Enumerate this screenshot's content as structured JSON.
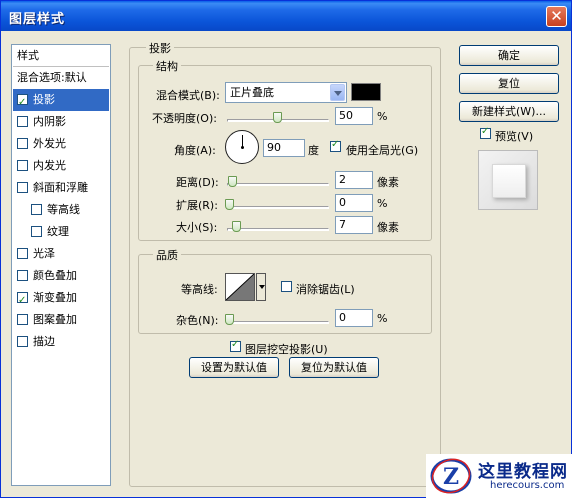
{
  "window": {
    "title": "图层样式",
    "close_glyph": "✕"
  },
  "style_list": {
    "header": "样式",
    "items": [
      {
        "label": "混合选项:默认",
        "checkbox": false,
        "checked": false,
        "selected": false
      },
      {
        "label": "投影",
        "checkbox": true,
        "checked": true,
        "selected": true
      },
      {
        "label": "内阴影",
        "checkbox": true,
        "checked": false,
        "selected": false
      },
      {
        "label": "外发光",
        "checkbox": true,
        "checked": false,
        "selected": false
      },
      {
        "label": "内发光",
        "checkbox": true,
        "checked": false,
        "selected": false
      },
      {
        "label": "斜面和浮雕",
        "checkbox": true,
        "checked": false,
        "selected": false
      },
      {
        "label": "等高线",
        "checkbox": true,
        "checked": false,
        "selected": false
      },
      {
        "label": "纹理",
        "checkbox": true,
        "checked": false,
        "selected": false
      },
      {
        "label": "光泽",
        "checkbox": true,
        "checked": false,
        "selected": false
      },
      {
        "label": "颜色叠加",
        "checkbox": true,
        "checked": false,
        "selected": false
      },
      {
        "label": "渐变叠加",
        "checkbox": true,
        "checked": true,
        "selected": false
      },
      {
        "label": "图案叠加",
        "checkbox": true,
        "checked": false,
        "selected": false
      },
      {
        "label": "描边",
        "checkbox": true,
        "checked": false,
        "selected": false
      }
    ]
  },
  "drop_shadow": {
    "title": "投影",
    "structure": {
      "title": "结构",
      "blend_mode_label": "混合模式(B):",
      "blend_mode_value": "正片叠底",
      "shadow_color": "#000000",
      "opacity_label": "不透明度(O):",
      "opacity_value": "50",
      "opacity_unit": "%",
      "opacity_level": 0.5,
      "angle_label": "角度(A):",
      "angle_value": "90",
      "angle_unit": "度",
      "global_light_label": "使用全局光(G)",
      "global_light_checked": true,
      "distance_label": "距离(D):",
      "distance_value": "2",
      "distance_unit": "像素",
      "spread_label": "扩展(R):",
      "spread_value": "0",
      "spread_unit": "%",
      "size_label": "大小(S):",
      "size_value": "7",
      "size_unit": "像素"
    },
    "quality": {
      "title": "品质",
      "contour_label": "等高线:",
      "antialias_label": "消除锯齿(L)",
      "antialias_checked": false,
      "noise_label": "杂色(N):",
      "noise_value": "0",
      "noise_unit": "%"
    },
    "knockout_label": "图层挖空投影(U)",
    "knockout_checked": true,
    "set_default_button": "设置为默认值",
    "reset_default_button": "复位为默认值"
  },
  "actions": {
    "ok": "确定",
    "reset": "复位",
    "new_style": "新建样式(W)...",
    "preview_label": "预览(V)",
    "preview_checked": true
  },
  "watermark": {
    "title": "这里教程网",
    "url": "herecours.com",
    "logo_letter": "Z"
  }
}
